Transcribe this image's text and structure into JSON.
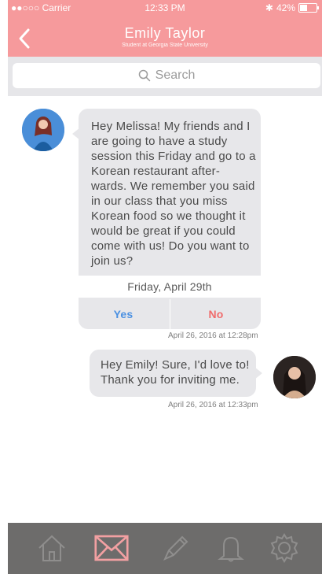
{
  "status": {
    "carrier": "●●○○○ Carrier",
    "time": "12:33 PM",
    "battery": "42%"
  },
  "header": {
    "title": "Emily Taylor",
    "subtitle": "Student at Georgia State University",
    "back_icon": "chevron-left-icon"
  },
  "search": {
    "placeholder": "Search",
    "icon": "search-icon"
  },
  "messages": [
    {
      "side": "left",
      "text": "Hey Melissa! My friends and I are going to have a study session this Friday and go to a Korean restaurant after- wards. We remember you said in our class that you miss Korean food so we thought it would be great if you could come with us! Do you want to join us?",
      "event_date": "Friday, April 29th",
      "yes_label": "Yes",
      "no_label": "No",
      "timestamp": "April 26, 2016 at 12:28pm"
    },
    {
      "side": "right",
      "text": "Hey Emily! Sure, I'd love to! Thank you for inviting me.",
      "timestamp": "April 26, 2016 at 12:33pm"
    }
  ],
  "tabbar": {
    "items": [
      {
        "name": "home",
        "icon": "home-icon",
        "active": false
      },
      {
        "name": "messages",
        "icon": "mail-icon",
        "active": true
      },
      {
        "name": "compose",
        "icon": "pencil-icon",
        "active": false
      },
      {
        "name": "notifications",
        "icon": "bell-icon",
        "active": false
      },
      {
        "name": "settings",
        "icon": "gear-icon",
        "active": false
      }
    ]
  },
  "colors": {
    "header": "#f69a9c",
    "bubble": "#e7e7ea",
    "tabbar": "#6d6c6b",
    "active_tab": "#f69a9c",
    "yes": "#4a90e2",
    "no": "#f06b6b"
  }
}
